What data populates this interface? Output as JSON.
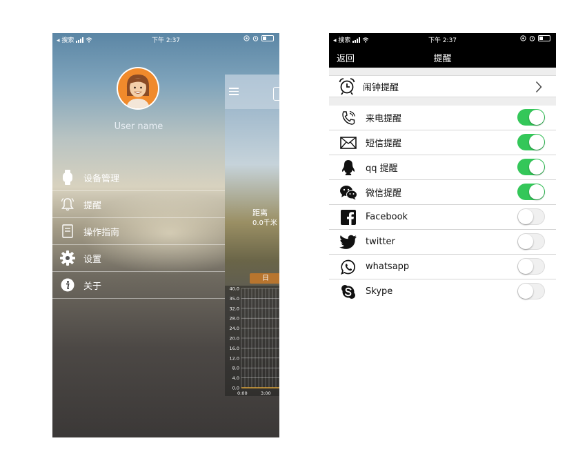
{
  "status_bar": {
    "carrier": "◂ 搜索",
    "time": "下午 2:37"
  },
  "left_screen": {
    "user_name": "User name",
    "menu": [
      {
        "label": "设备管理",
        "icon": "watch-icon"
      },
      {
        "label": "提醒",
        "icon": "bell-icon"
      },
      {
        "label": "操作指南",
        "icon": "guide-book-icon"
      },
      {
        "label": "设置",
        "icon": "gear-icon"
      },
      {
        "label": "关于",
        "icon": "info-icon"
      }
    ],
    "main_glimpse": {
      "distance_label": "距离",
      "distance_value": "0.0千米",
      "period_tab": "日"
    }
  },
  "chart_data": {
    "type": "bar",
    "y_ticks": [
      "40.0",
      "35.0",
      "32.0",
      "28.0",
      "24.0",
      "20.0",
      "16.0",
      "12.0",
      "8.0",
      "4.0",
      "0.0"
    ],
    "x_ticks": [
      "0:00",
      "3:00"
    ],
    "values": [],
    "grid": true
  },
  "right_screen": {
    "nav": {
      "back": "返回",
      "title": "提醒"
    },
    "alarm": {
      "label": "闹钟提醒",
      "icon": "alarm-clock-icon"
    },
    "reminders": [
      {
        "label": "来电提醒",
        "icon": "phone-icon",
        "enabled": true
      },
      {
        "label": "短信提醒",
        "icon": "envelope-icon",
        "enabled": true
      },
      {
        "label": "qq 提醒",
        "icon": "qq-icon",
        "enabled": true
      },
      {
        "label": "微信提醒",
        "icon": "wechat-icon",
        "enabled": true
      },
      {
        "label": "Facebook",
        "icon": "facebook-icon",
        "enabled": false
      },
      {
        "label": "twitter",
        "icon": "twitter-icon",
        "enabled": false
      },
      {
        "label": "whatsapp",
        "icon": "whatsapp-icon",
        "enabled": false
      },
      {
        "label": "Skype",
        "icon": "skype-icon",
        "enabled": false
      }
    ]
  },
  "colors": {
    "toggle_on": "#34c759",
    "nav_bg": "#000000",
    "day_tab": "#b8752e",
    "avatar_bg": "#f08a2c"
  }
}
